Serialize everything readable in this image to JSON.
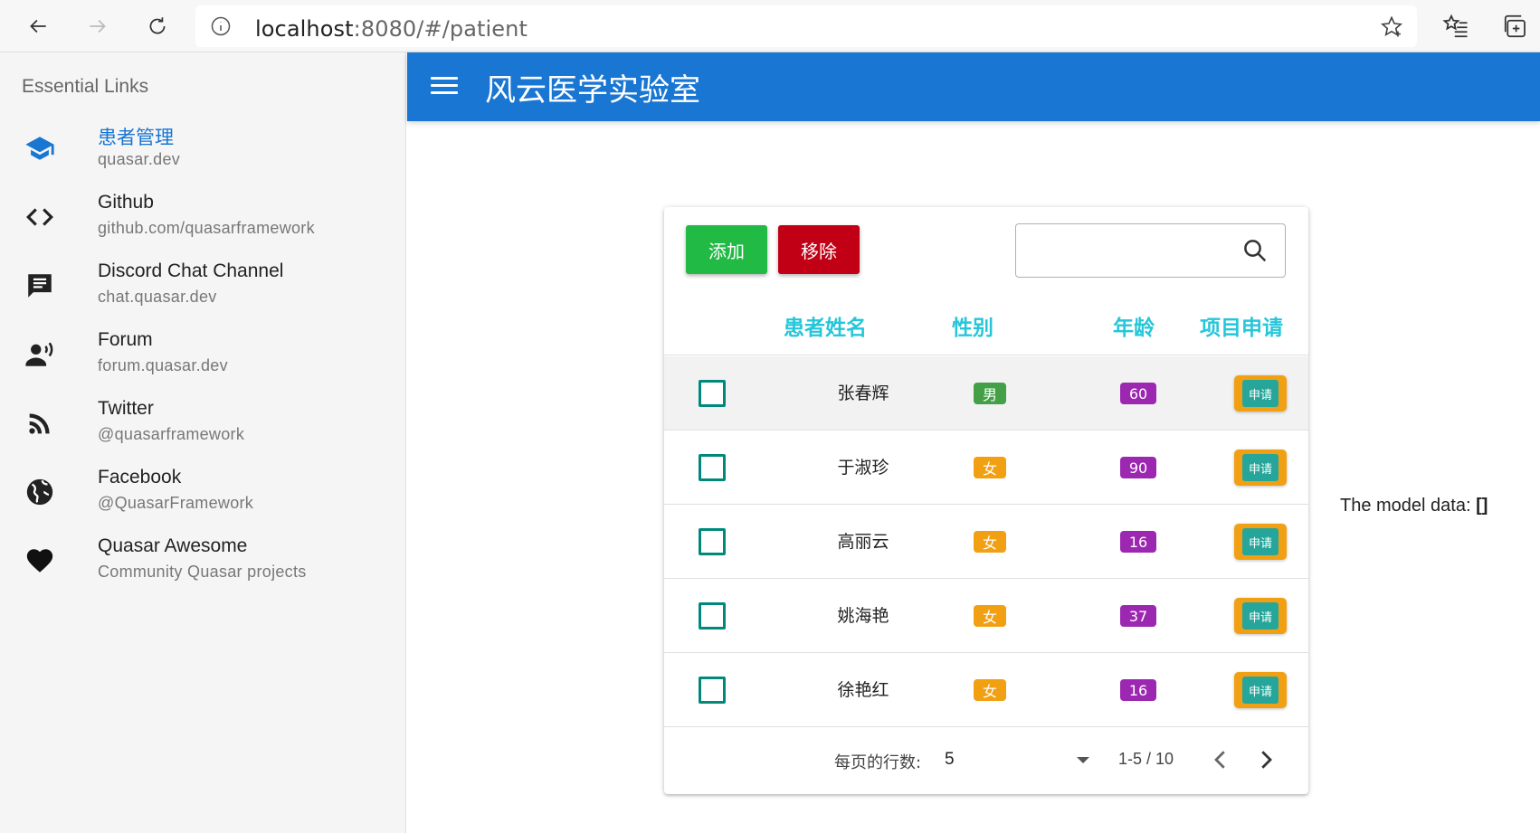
{
  "browser": {
    "url_host": "localhost",
    "url_rest": ":8080/#/patient"
  },
  "drawer": {
    "header": "Essential Links",
    "links": [
      {
        "title": "患者管理",
        "caption": "quasar.dev",
        "icon": "school-icon"
      },
      {
        "title": "Github",
        "caption": "github.com/quasarframework",
        "icon": "code-icon"
      },
      {
        "title": "Discord Chat Channel",
        "caption": "chat.quasar.dev",
        "icon": "chat-icon"
      },
      {
        "title": "Forum",
        "caption": "forum.quasar.dev",
        "icon": "record-voice-icon"
      },
      {
        "title": "Twitter",
        "caption": "@quasarframework",
        "icon": "rss-feed-icon"
      },
      {
        "title": "Facebook",
        "caption": "@QuasarFramework",
        "icon": "public-globe-icon"
      },
      {
        "title": "Quasar Awesome",
        "caption": "Community Quasar projects",
        "icon": "favorite-heart-icon"
      }
    ]
  },
  "header": {
    "title": "风云医学实验室"
  },
  "toolbar": {
    "add_label": "添加",
    "remove_label": "移除",
    "search_placeholder": ""
  },
  "table": {
    "columns": [
      "患者姓名",
      "性别",
      "年龄",
      "项目申请"
    ],
    "rows": [
      {
        "name": "张春辉",
        "gender": "男",
        "age": "60",
        "apply": "申请"
      },
      {
        "name": "于淑珍",
        "gender": "女",
        "age": "90",
        "apply": "申请"
      },
      {
        "name": "高丽云",
        "gender": "女",
        "age": "16",
        "apply": "申请"
      },
      {
        "name": "姚海艳",
        "gender": "女",
        "age": "37",
        "apply": "申请"
      },
      {
        "name": "徐艳红",
        "gender": "女",
        "age": "16",
        "apply": "申请"
      }
    ]
  },
  "colors": {
    "primary": "#1976d2",
    "male_badge": "#43a047",
    "female_badge": "#f2a013",
    "age_badge": "#9c27b0",
    "header_text": "#26c6da"
  },
  "pagination": {
    "rows_per_page_label": "每页的行数:",
    "rows_per_page_value": "5",
    "range": "1-5 / 10"
  },
  "model": {
    "label": "The model data:",
    "value": "[]"
  }
}
